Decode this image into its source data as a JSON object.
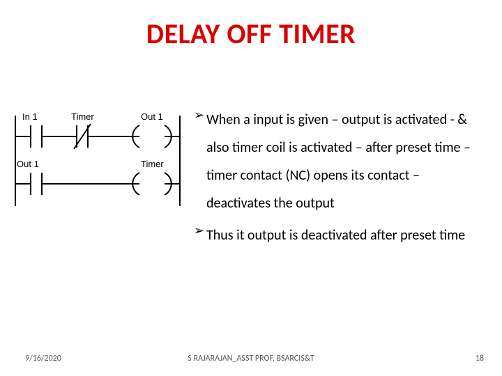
{
  "title": "DELAY OFF TIMER",
  "diagram": {
    "labels": {
      "in1": "In 1",
      "timer_top": "Timer",
      "out1_top": "Out 1",
      "out1_left": "Out 1",
      "timer_right": "Timer"
    }
  },
  "bullets": [
    "When a input is given – output is activated - & also timer coil is activated – after preset time – timer contact  (NC) opens its contact – deactivates the output",
    "Thus it output is deactivated after preset time"
  ],
  "footer": {
    "date": "9/16/2020",
    "center": "S RAJARAJAN_ASST PROF, BSARCIS&T",
    "page": "18"
  }
}
